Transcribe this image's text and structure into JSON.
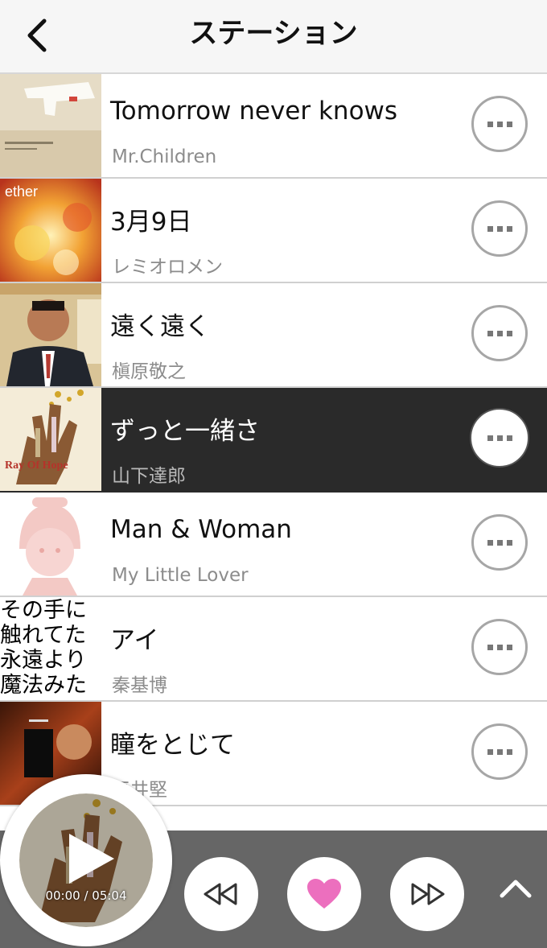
{
  "header": {
    "title": "ステーション",
    "back_icon": "chevron-left-icon"
  },
  "songs": [
    {
      "title": "Tomorrow never knows",
      "artist": "Mr.Children"
    },
    {
      "title": "3月9日",
      "artist": "レミオロメン",
      "art_text": "ether"
    },
    {
      "title": "遠く遠く",
      "artist": "槇原敬之"
    },
    {
      "title": "ずっと一緒さ",
      "artist": "山下達郎",
      "active": true,
      "art_text": "Ray Of Hope"
    },
    {
      "title": "Man & Woman",
      "artist": "My Little Lover"
    },
    {
      "title": "アイ",
      "artist": "秦基博",
      "art_lines": [
        "その手に",
        "触れてた",
        "永遠より",
        "魔法みた"
      ]
    },
    {
      "title": "瞳をとじて",
      "artist": "平井堅"
    }
  ],
  "player": {
    "time": "00:00 / 05:04",
    "controls": [
      "rewind-icon",
      "heart-icon",
      "fast-forward-icon",
      "chevron-up-icon"
    ]
  },
  "colors": {
    "active_row": "#2a2a2a",
    "player_bar": "#666666",
    "heart": "#ec6fbe"
  }
}
